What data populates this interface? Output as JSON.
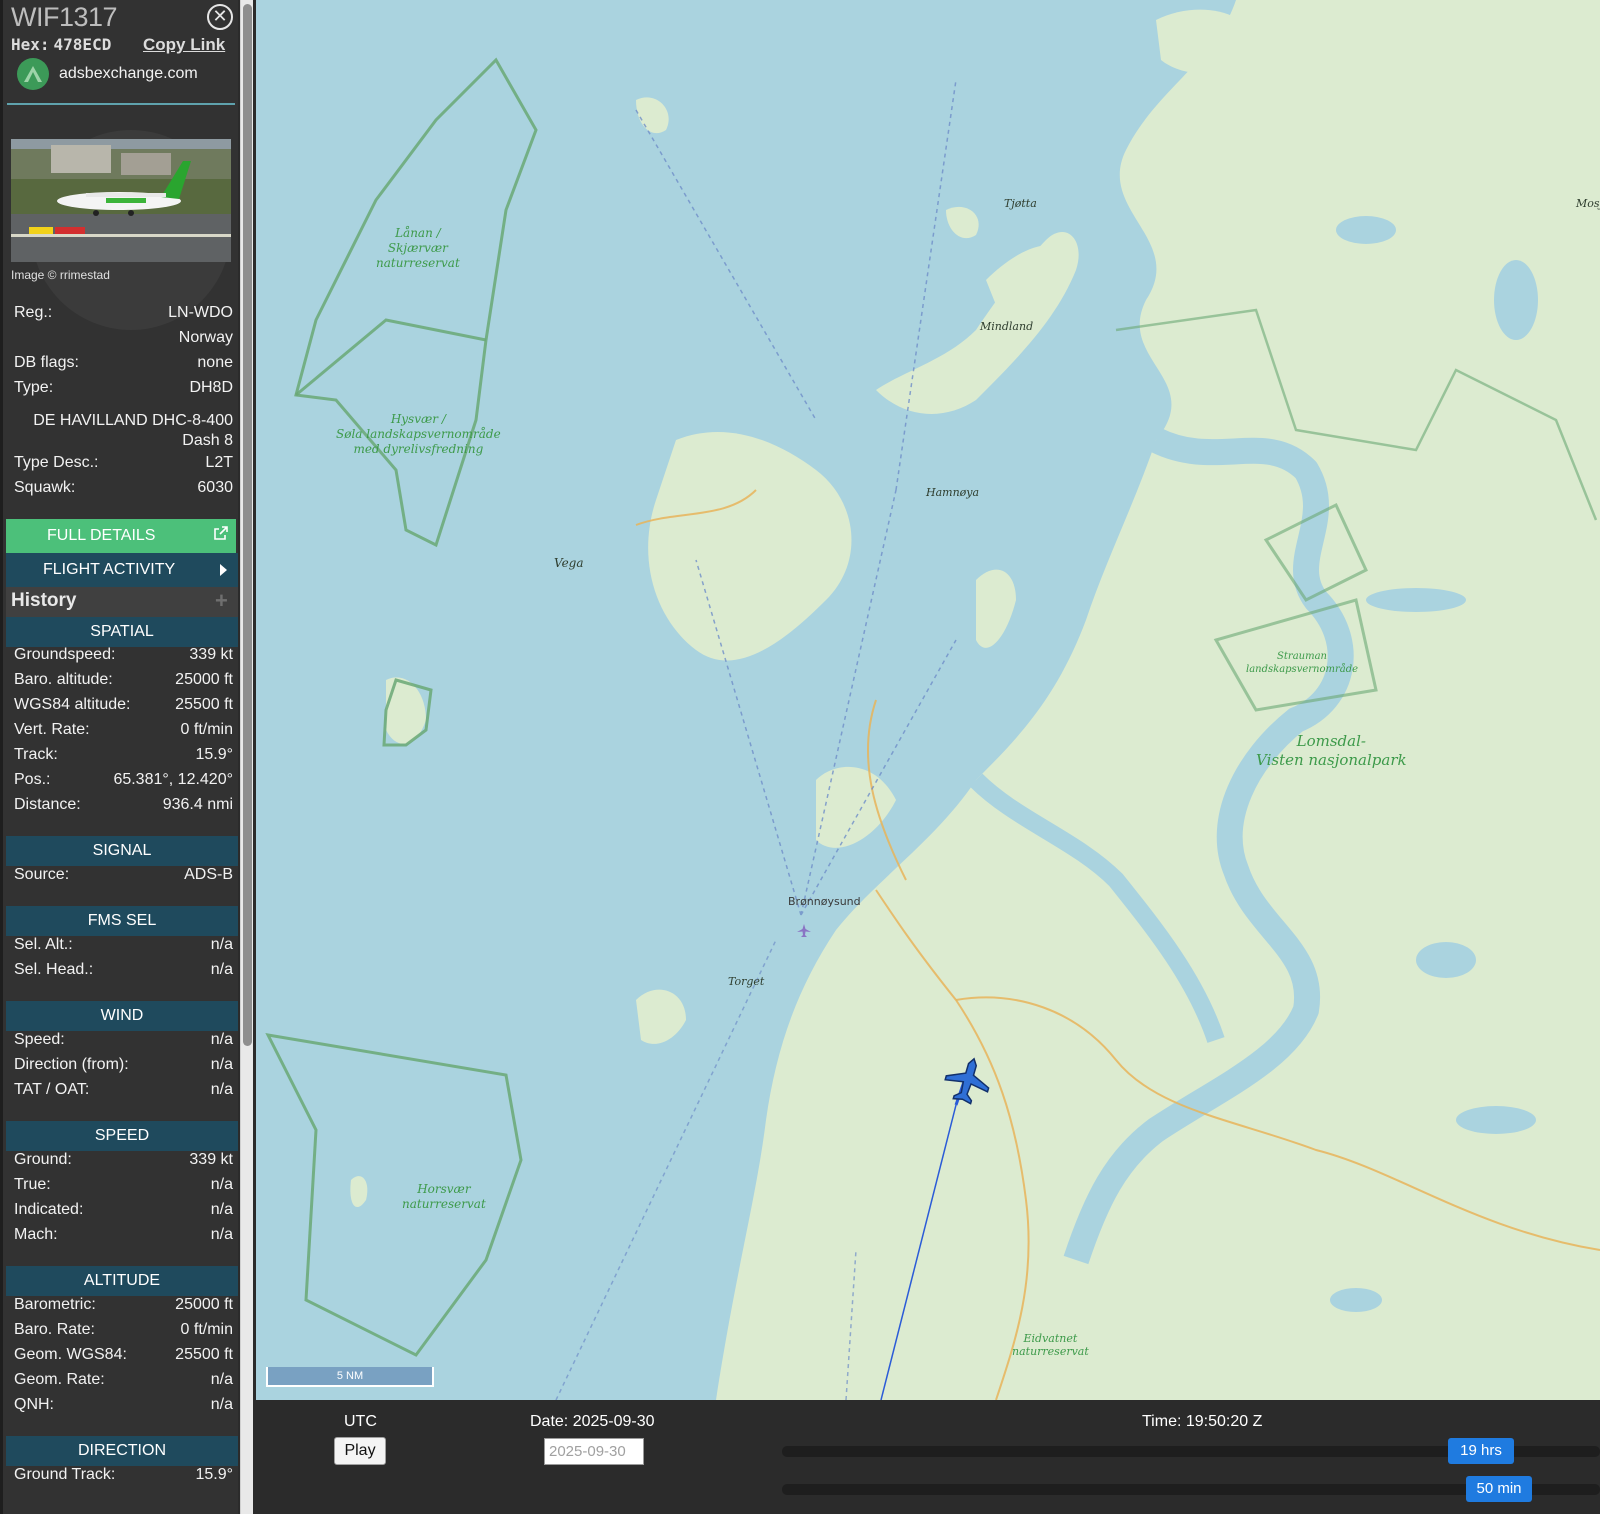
{
  "aircraft": {
    "callsign": "WIF1317",
    "hex_label": "Hex:",
    "hex": "478ECD",
    "copy_link": "Copy Link",
    "brand": "adsbexchange.com",
    "photo_credit": "Image © rrimestad"
  },
  "info": {
    "reg_label": "Reg.:",
    "reg": "LN-WDO",
    "country": "Norway",
    "db_flags_label": "DB flags:",
    "db_flags": "none",
    "type_label": "Type:",
    "type": "DH8D",
    "type_name_line1": "DE HAVILLAND DHC-8-400",
    "type_name_line2": "Dash 8",
    "type_desc_label": "Type Desc.:",
    "type_desc": "L2T",
    "squawk_label": "Squawk:",
    "squawk": "6030"
  },
  "buttons": {
    "full_details": "FULL DETAILS",
    "flight_activity": "FLIGHT ACTIVITY",
    "history": "History"
  },
  "spatial": {
    "header": "SPATIAL",
    "rows": [
      {
        "label": "Groundspeed:",
        "value": "339 kt"
      },
      {
        "label": "Baro. altitude:",
        "value": "25000 ft"
      },
      {
        "label": "WGS84 altitude:",
        "value": "25500 ft"
      },
      {
        "label": "Vert. Rate:",
        "value": "0 ft/min"
      },
      {
        "label": "Track:",
        "value": "15.9°"
      },
      {
        "label": "Pos.:",
        "value": "65.381°, 12.420°"
      },
      {
        "label": "Distance:",
        "value": "936.4 nmi"
      }
    ]
  },
  "signal": {
    "header": "SIGNAL",
    "rows": [
      {
        "label": "Source:",
        "value": "ADS-B"
      }
    ]
  },
  "fms_sel": {
    "header": "FMS SEL",
    "rows": [
      {
        "label": "Sel. Alt.:",
        "value": "n/a"
      },
      {
        "label": "Sel. Head.:",
        "value": "n/a"
      }
    ]
  },
  "wind": {
    "header": "WIND",
    "rows": [
      {
        "label": "Speed:",
        "value": "n/a"
      },
      {
        "label": "Direction (from):",
        "value": "n/a"
      },
      {
        "label": "TAT / OAT:",
        "value": "n/a"
      }
    ]
  },
  "speed": {
    "header": "SPEED",
    "rows": [
      {
        "label": "Ground:",
        "value": "339 kt"
      },
      {
        "label": "True:",
        "value": "n/a"
      },
      {
        "label": "Indicated:",
        "value": "n/a"
      },
      {
        "label": "Mach:",
        "value": "n/a"
      }
    ]
  },
  "altitude": {
    "header": "ALTITUDE",
    "rows": [
      {
        "label": "Barometric:",
        "value": "25000 ft"
      },
      {
        "label": "Baro. Rate:",
        "value": "0 ft/min"
      },
      {
        "label": "Geom. WGS84:",
        "value": "25500 ft"
      },
      {
        "label": "Geom. Rate:",
        "value": "n/a"
      },
      {
        "label": "QNH:",
        "value": "n/a"
      }
    ]
  },
  "direction": {
    "header": "DIRECTION",
    "rows": [
      {
        "label": "Ground Track:",
        "value": "15.9°"
      }
    ]
  },
  "map": {
    "labels": {
      "lanan": "Lånan /\nSkjærvær\nnaturreservat",
      "hysvaer": "Hysvær /\nSøla landskapsvernområde\nmed dyrelivsfredning",
      "vega": "Vega",
      "tjotta": "Tjøtta",
      "mindland": "Mindland",
      "hamnoya": "Hamnøya",
      "mosj": "Mosj",
      "strauman": "Strauman\nlandskapsvernområde",
      "lomsdal": "Lomsdal-\nVisten nasjonalpark",
      "bronnoysund": "Brønnøysund",
      "torget": "Torget",
      "horsvaer": "Horsvær\nnaturreservat",
      "eidvatnet": "Eidvatnet\nnaturreservat"
    },
    "scale": "5 NM",
    "colors": {
      "water": "#aad3df",
      "land": "#dcebd0",
      "protected": "#6aa875",
      "track": "#2a5bd7",
      "aircraft": "#2f6fd6"
    }
  },
  "timeline": {
    "timezone": "UTC",
    "date_text": "Date: 2025-09-30",
    "time_text": "Time: 19:50:20 Z",
    "play": "Play",
    "date_input_value": "2025-09-30",
    "slider_hours": "19 hrs",
    "slider_minutes": "50 min"
  }
}
